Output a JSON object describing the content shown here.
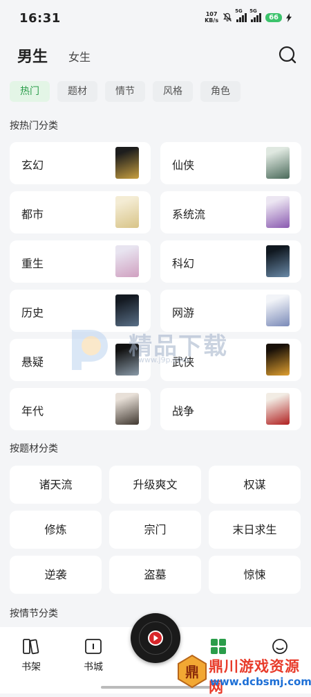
{
  "status_bar": {
    "time": "16:31",
    "net_speed_value": "107",
    "net_speed_unit": "KB/s",
    "signal1_label": "5G",
    "signal2_label": "5G",
    "battery": "66"
  },
  "header": {
    "tab_male": "男生",
    "tab_female": "女生"
  },
  "chips": [
    "热门",
    "题材",
    "情节",
    "风格",
    "角色"
  ],
  "hot_section": {
    "title": "按热门分类",
    "items": [
      {
        "name": "玄幻",
        "cover": [
          "#1d1d1d",
          "#c8a040"
        ]
      },
      {
        "name": "仙侠",
        "cover": [
          "#dfe8e0",
          "#4a6a5a"
        ]
      },
      {
        "name": "都市",
        "cover": [
          "#f4ecd4",
          "#d8c488"
        ]
      },
      {
        "name": "系统流",
        "cover": [
          "#ece6f2",
          "#8a5ab0"
        ]
      },
      {
        "name": "重生",
        "cover": [
          "#e8e4f0",
          "#d0a0c0"
        ]
      },
      {
        "name": "科幻",
        "cover": [
          "#101820",
          "#6a8aa8"
        ]
      },
      {
        "name": "历史",
        "cover": [
          "#141a22",
          "#5a7088"
        ]
      },
      {
        "name": "网游",
        "cover": [
          "#f2f4f8",
          "#7a8ab8"
        ]
      },
      {
        "name": "悬疑",
        "cover": [
          "#121212",
          "#8a9aa8"
        ]
      },
      {
        "name": "武侠",
        "cover": [
          "#181008",
          "#e0a030"
        ]
      },
      {
        "name": "年代",
        "cover": [
          "#e8e0d8",
          "#403830"
        ]
      },
      {
        "name": "战争",
        "cover": [
          "#f2ece4",
          "#b02020"
        ]
      }
    ]
  },
  "theme_section": {
    "title": "按题材分类",
    "items": [
      "诸天流",
      "升级爽文",
      "权谋",
      "修炼",
      "宗门",
      "末日求生",
      "逆袭",
      "盗墓",
      "惊悚"
    ]
  },
  "plot_section": {
    "title": "按情节分类"
  },
  "bottom_nav": {
    "bookshelf": "书架",
    "bookcity": "书城"
  },
  "watermark": {
    "text": "精品下载",
    "url": "www.j9p.com"
  },
  "corner_logo": {
    "name": "鼎川游戏资源网",
    "url": "www.dcbsmj.com",
    "seal_char": "鼎"
  },
  "colors": {
    "accent_green": "#2a9d4a",
    "active_chip_bg": "#e3f5e6",
    "player_red": "#d8262a",
    "logo_red": "#e83b2a",
    "logo_blue": "#1d6fd6"
  }
}
